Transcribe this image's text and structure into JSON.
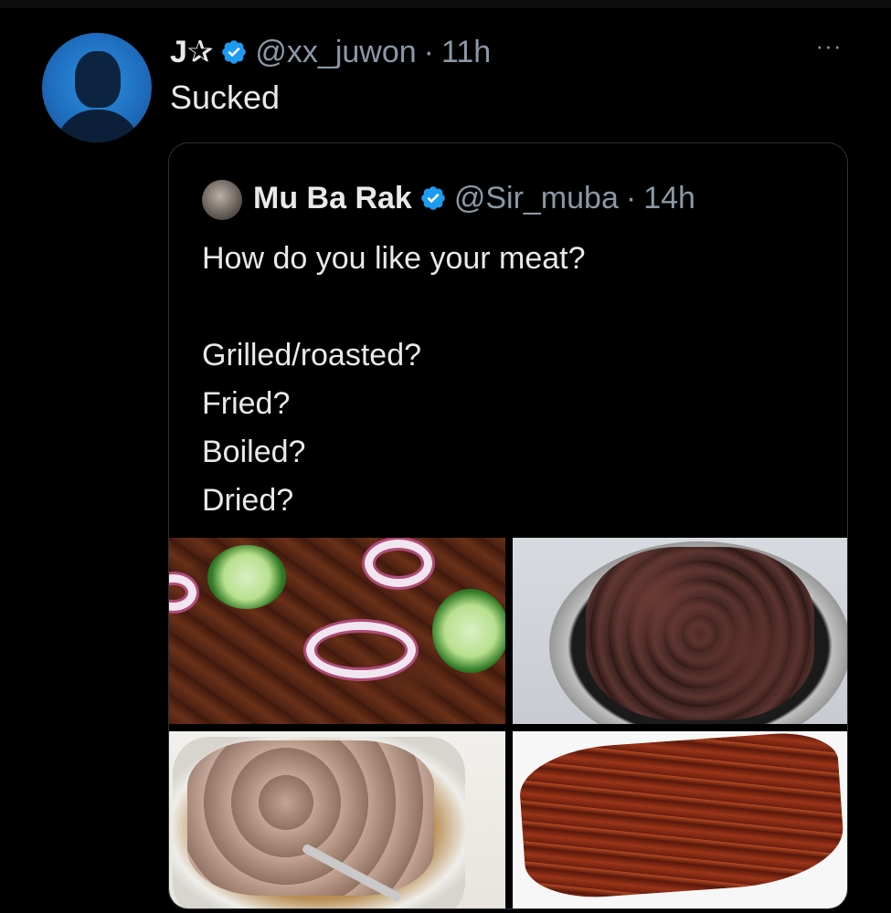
{
  "outer_tweet": {
    "display_name": "J✰",
    "handle": "@xx_juwon",
    "separator": "·",
    "time": "11h",
    "text": "Sucked",
    "more_label": "···"
  },
  "quoted_tweet": {
    "display_name": "Mu Ba Rak",
    "handle": "@Sir_muba",
    "separator": "·",
    "time": "14h",
    "text": "How do you like your meat?\n\nGrilled/roasted?\nFried?\nBoiled?\nDried?"
  },
  "images": [
    "grilled meat with cucumber and onion",
    "fried meat in bowl",
    "boiled meat in pot",
    "dried meat"
  ],
  "colors": {
    "background": "#000000",
    "text_primary": "#e7e9ea",
    "text_secondary": "#8b98a5",
    "verified": "#1d9bf0",
    "card_border": "#2f3336"
  }
}
